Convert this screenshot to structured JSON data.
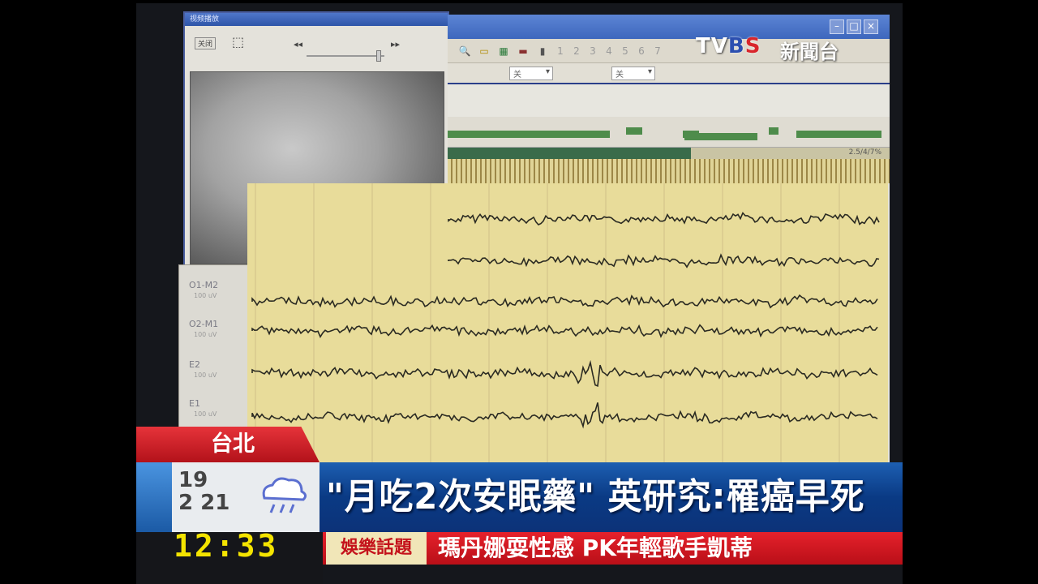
{
  "broadcast": {
    "logo_tv": "TV",
    "logo_b": "B",
    "logo_s": "S",
    "logo_channel": "新聞台",
    "location": "台北",
    "headline": "\"月吃2次安眠藥\" 英研究:罹癌早死",
    "clock": "12:33",
    "ticker_category": "娛樂話題",
    "ticker_text": "瑪丹娜耍性感 PK年輕歌手凱蒂",
    "weather_text": "19\n2 21",
    "weather_icon": "rain-cloud-icon"
  },
  "eeg_window": {
    "toolbar_pages": [
      "1",
      "2",
      "3",
      "4",
      "5",
      "6",
      "7"
    ],
    "filter_value_1": "关",
    "filter_value_2": "关",
    "status_value": "2.5/4/7%"
  },
  "channels": [
    {
      "label": "O1-M2",
      "sub": "100 uV"
    },
    {
      "label": "O2-M1",
      "sub": "100 uV"
    },
    {
      "label": "E2",
      "sub": "100 uV"
    },
    {
      "label": "E1",
      "sub": "100 uV"
    }
  ],
  "video_window": {
    "title": "视频播放",
    "btn_label": "关闭",
    "rewind": "◂◂",
    "forward": "▸▸"
  },
  "colors": {
    "eeg_bg": "#e8dc9a",
    "headline_blue": "#0a3a84",
    "ticker_red": "#c4121b",
    "clock_yellow": "#f4e400"
  }
}
